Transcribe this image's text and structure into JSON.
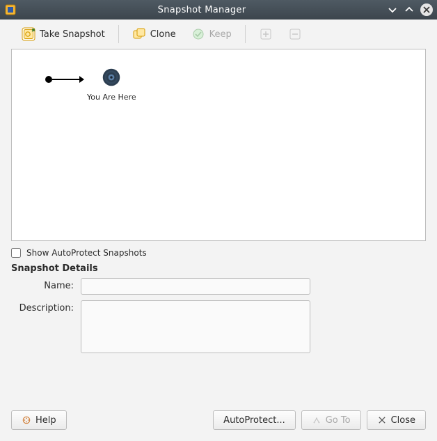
{
  "title": "Snapshot Manager",
  "toolbar": {
    "take_snapshot": "Take Snapshot",
    "clone": "Clone",
    "keep": "Keep"
  },
  "tree": {
    "you_are_here": "You Are Here"
  },
  "checkbox": {
    "show_autoprotect": "Show AutoProtect Snapshots",
    "checked": false
  },
  "details": {
    "header": "Snapshot Details",
    "name_label": "Name:",
    "name_value": "",
    "description_label": "Description:",
    "description_value": ""
  },
  "footer": {
    "help": "Help",
    "autoprotect": "AutoProtect...",
    "goto": "Go To",
    "close": "Close"
  },
  "colors": {
    "titlebar_start": "#4f5a63",
    "titlebar_end": "#3c454d",
    "panel_bg": "#f3f3f3",
    "border": "#bdbdbd",
    "text": "#2b2b2b",
    "disabled_text": "#a9a9a9"
  }
}
